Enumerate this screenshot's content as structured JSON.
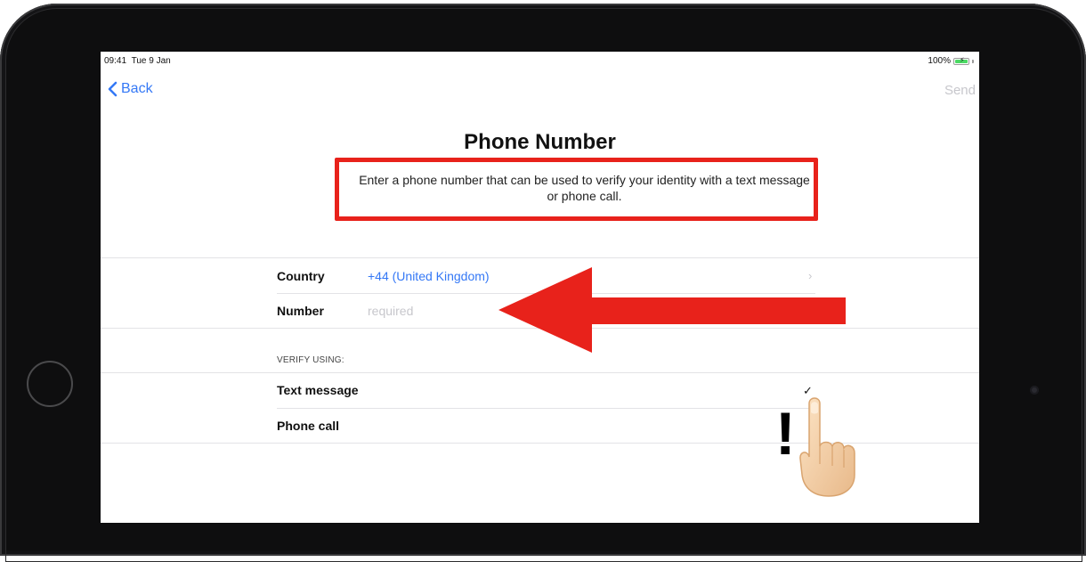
{
  "status_bar": {
    "time": "09:41",
    "date": "Tue 9 Jan",
    "battery_percent": "100%",
    "battery_level": 1.0
  },
  "nav": {
    "back_label": "Back",
    "send_label": "Send"
  },
  "page": {
    "title": "Phone Number",
    "description": "Enter a phone number that can be used to verify your identity with a text message or phone call."
  },
  "form": {
    "country_label": "Country",
    "country_value": "+44 (United Kingdom)",
    "number_label": "Number",
    "number_placeholder": "required"
  },
  "verify": {
    "header": "VERIFY USING:",
    "options": [
      {
        "label": "Text message",
        "selected": true
      },
      {
        "label": "Phone call",
        "selected": false
      }
    ]
  },
  "annotation": {
    "exclamation": "!"
  },
  "colors": {
    "accent": "#3478f6",
    "highlight": "#e8221b",
    "disabled": "#c7c7cc"
  }
}
